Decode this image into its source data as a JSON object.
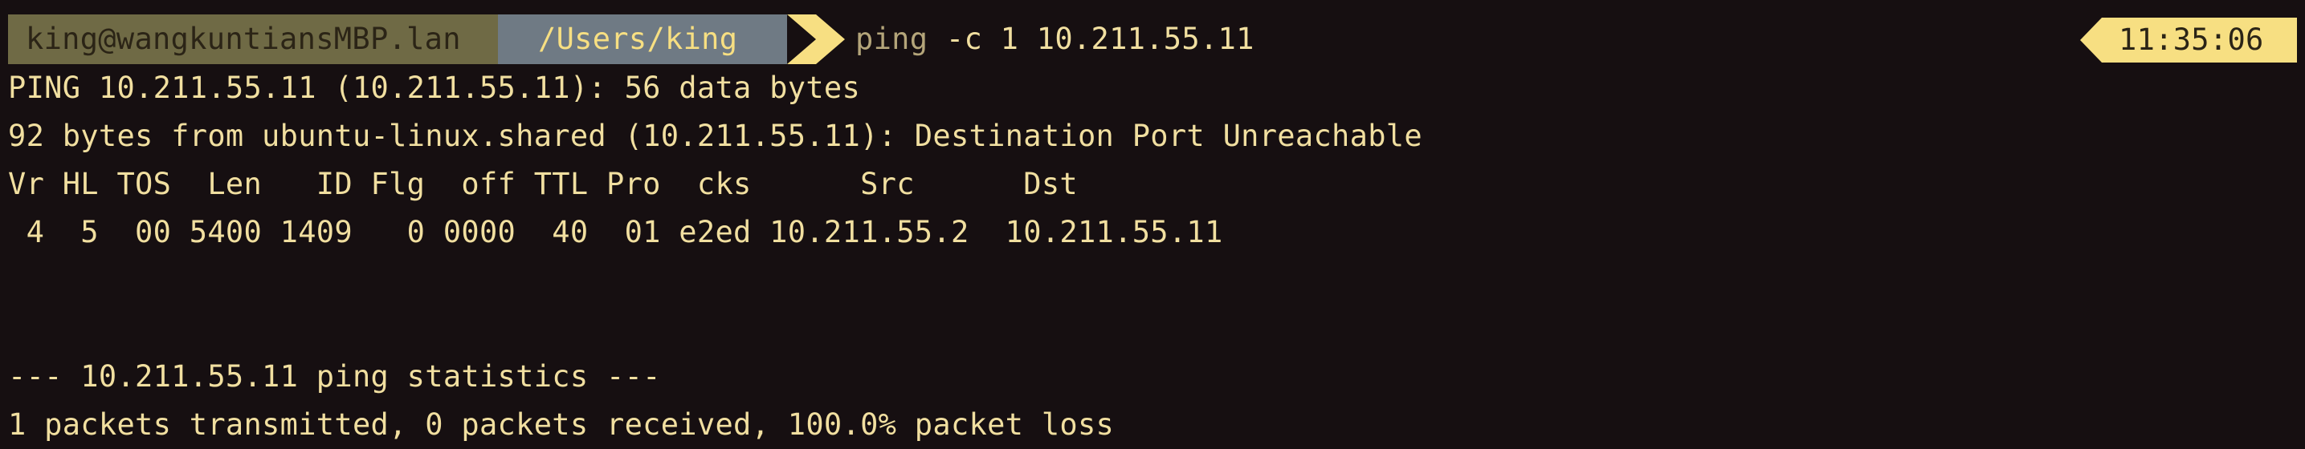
{
  "prompt": {
    "user_host": "king@wangkuntiansMBP.lan",
    "path": "/Users/king",
    "command": "ping",
    "args": "-c 1 10.211.55.11",
    "time": "11:35:06"
  },
  "output": [
    "PING 10.211.55.11 (10.211.55.11): 56 data bytes",
    "92 bytes from ubuntu-linux.shared (10.211.55.11): Destination Port Unreachable",
    "Vr HL TOS  Len   ID Flg  off TTL Pro  cks      Src      Dst",
    " 4  5  00 5400 1409   0 0000  40  01 e2ed 10.211.55.2  10.211.55.11",
    "",
    "",
    "--- 10.211.55.11 ping statistics ---",
    "1 packets transmitted, 0 packets received, 100.0% packet loss"
  ],
  "colors": {
    "background": "#160f11",
    "text": "#f1dfa0",
    "user_segment": "#6f6a45",
    "path_segment": "#6f7a84",
    "accent": "#f7df82"
  }
}
